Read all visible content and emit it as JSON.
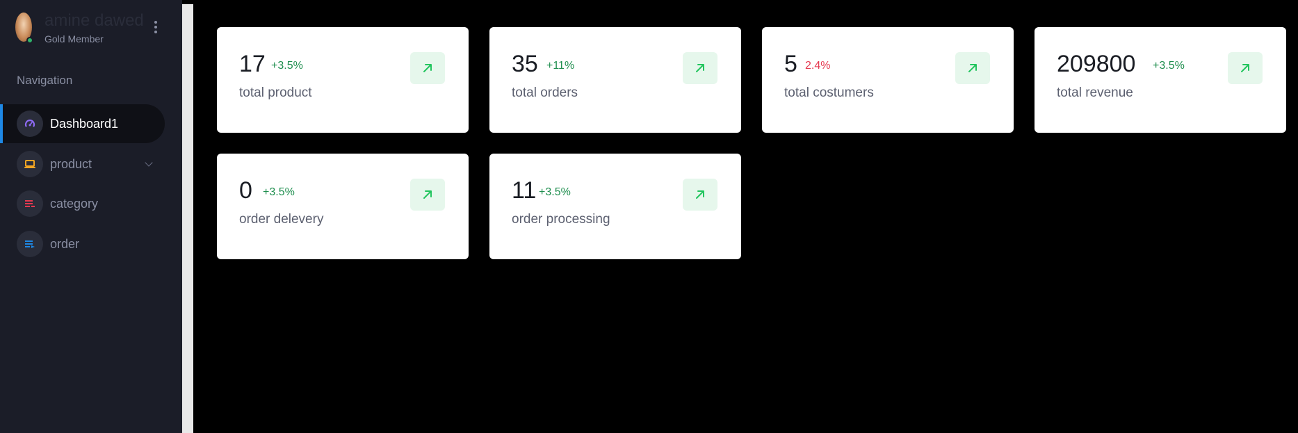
{
  "user": {
    "name": "amine dawed",
    "role": "Gold Member"
  },
  "navigation": {
    "title": "Navigation",
    "items": [
      {
        "label": "Dashboard1",
        "icon": "speedometer-icon",
        "icon_color": "#8e6bf5",
        "active": true
      },
      {
        "label": "product",
        "icon": "laptop-icon",
        "icon_color": "#f5a623",
        "has_submenu": true
      },
      {
        "label": "category",
        "icon": "list-icon",
        "icon_color": "#e53950"
      },
      {
        "label": "order",
        "icon": "list-icon",
        "icon_color": "#1e88e5"
      }
    ]
  },
  "stats": [
    {
      "value": "17",
      "change": "+3.5%",
      "label": "total product",
      "trend_color": "#1e8e4e",
      "icon": "arrow-up-right-icon"
    },
    {
      "value": "35",
      "change": "+11%",
      "label": "total orders",
      "trend_color": "#1e8e4e",
      "icon": "arrow-up-right-icon"
    },
    {
      "value": "5",
      "change": "2.4%",
      "label": "total costumers",
      "trend_color": "#e53950",
      "icon": "arrow-up-right-icon"
    },
    {
      "value": "209800",
      "change": "+3.5%",
      "label": "total revenue",
      "trend_color": "#1e8e4e",
      "icon": "arrow-up-right-icon"
    },
    {
      "value": "0",
      "change": "+3.5%",
      "label": "order delevery",
      "trend_color": "#1e8e4e",
      "icon": "arrow-up-right-icon"
    },
    {
      "value": "11",
      "change": "+3.5%",
      "label": "order processing",
      "trend_color": "#1e8e4e",
      "icon": "arrow-up-right-icon"
    }
  ],
  "colors": {
    "sidebar_bg": "#1b1d28",
    "page_bg": "#000000",
    "active_indicator": "#1e88e5",
    "badge_bg": "#e6f7ec",
    "badge_arrow": "#22c55e"
  }
}
